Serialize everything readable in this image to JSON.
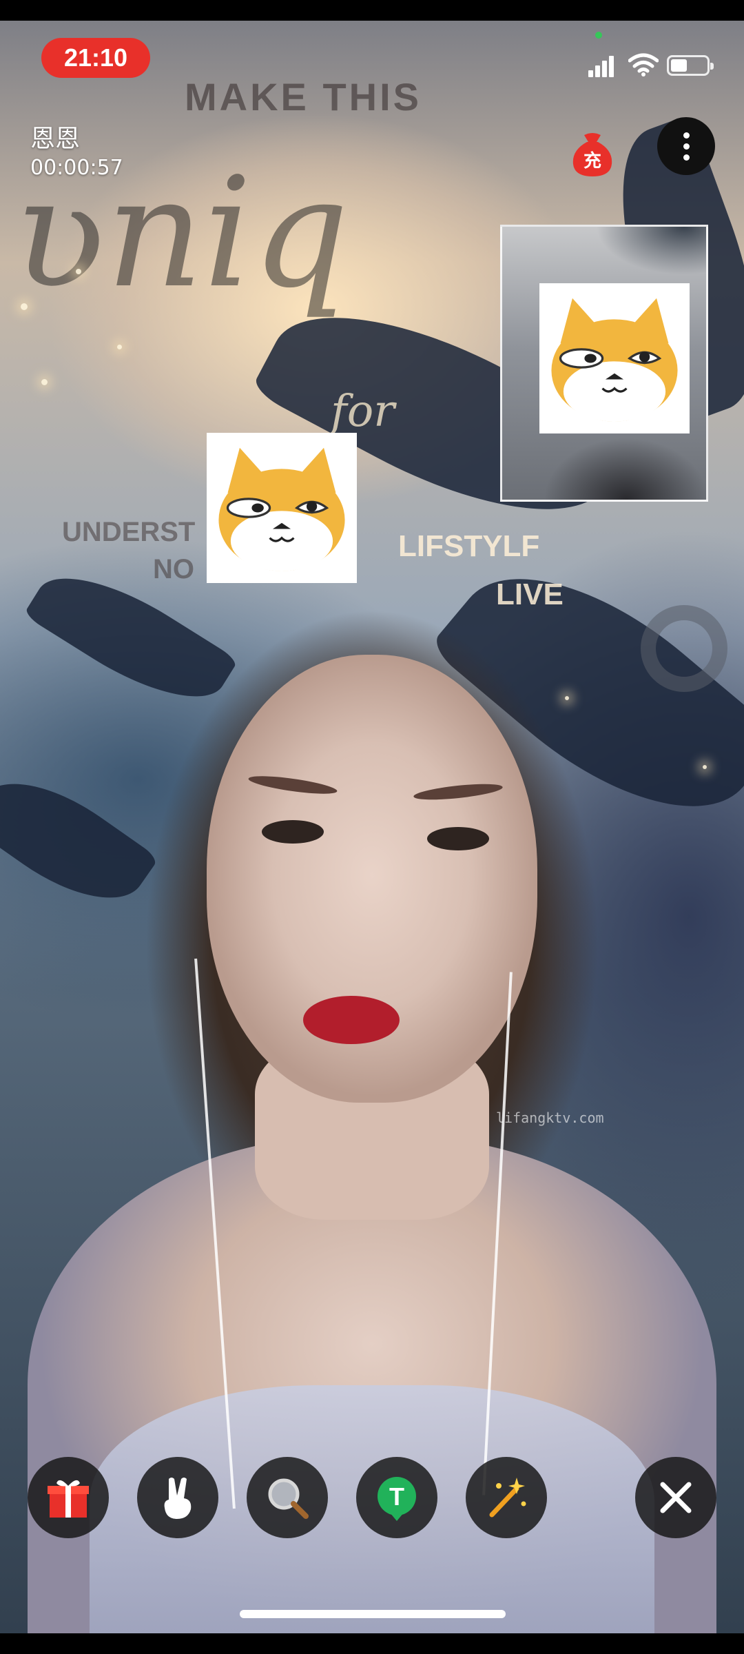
{
  "status_bar": {
    "time": "21:10",
    "battery_level": 0.45,
    "accent_color": "#e8302a"
  },
  "caller": {
    "name": "恩恩",
    "duration": "00:00:57"
  },
  "top_controls": {
    "recharge_icon_label": "充",
    "recharge_icon": "red-money-bag-icon",
    "more_icon": "three-dots-vertical-icon"
  },
  "self_preview": {
    "sticker": "shiba-dog-sticker"
  },
  "remote_video": {
    "sticker": "shiba-dog-sticker",
    "watermark": "lifangktv.com",
    "background_text": [
      "MAKE THIS",
      "for",
      "UNDERST",
      "NO",
      "LIFSTYLF",
      "LIVE"
    ]
  },
  "actions": [
    {
      "name": "gift-button",
      "icon": "gift-icon"
    },
    {
      "name": "gesture-button",
      "icon": "victory-hand-icon"
    },
    {
      "name": "search-button",
      "icon": "magnifier-icon"
    },
    {
      "name": "text-button",
      "icon": "text-t-icon",
      "label": "T"
    },
    {
      "name": "effects-button",
      "icon": "magic-wand-icon"
    },
    {
      "name": "hangup-button",
      "icon": "close-icon"
    }
  ]
}
